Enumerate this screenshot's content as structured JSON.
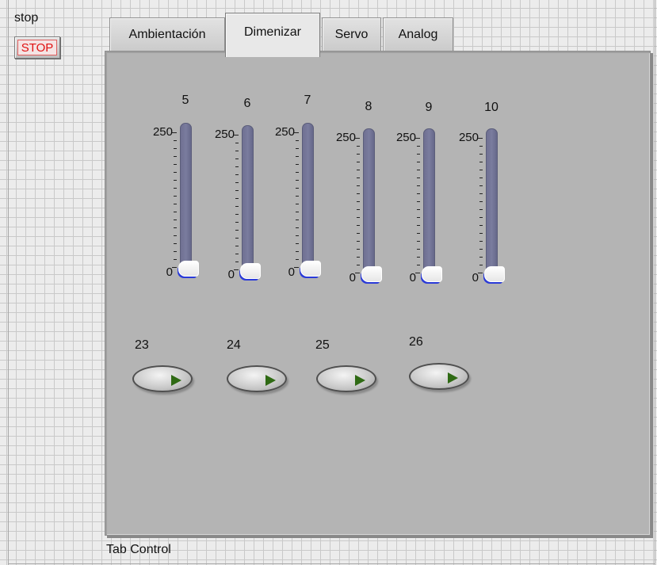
{
  "stop_control": {
    "label": "stop",
    "button_text": "STOP"
  },
  "tab_control": {
    "label": "Tab Control",
    "tabs": [
      {
        "label": "Ambientación",
        "active": false
      },
      {
        "label": "Dimenizar",
        "active": true
      },
      {
        "label": "Servo",
        "active": false
      },
      {
        "label": "Analog",
        "active": false
      }
    ]
  },
  "sliders": [
    {
      "label": "5",
      "max": "250",
      "min": "0",
      "value": 0
    },
    {
      "label": "6",
      "max": "250",
      "min": "0",
      "value": 0
    },
    {
      "label": "7",
      "max": "250",
      "min": "0",
      "value": 0
    },
    {
      "label": "8",
      "max": "250",
      "min": "0",
      "value": 0
    },
    {
      "label": "9",
      "max": "250",
      "min": "0",
      "value": 0
    },
    {
      "label": "10",
      "max": "250",
      "min": "0",
      "value": 0
    }
  ],
  "buttons": [
    {
      "label": "23",
      "state": "off"
    },
    {
      "label": "24",
      "state": "off"
    },
    {
      "label": "25",
      "state": "off"
    },
    {
      "label": "26",
      "state": "off"
    }
  ],
  "colors": {
    "stop_text": "#e01010",
    "panel_bg": "#b4b4b4",
    "slider_track": "#6f7092",
    "led_arrow": "#2f6a14"
  }
}
